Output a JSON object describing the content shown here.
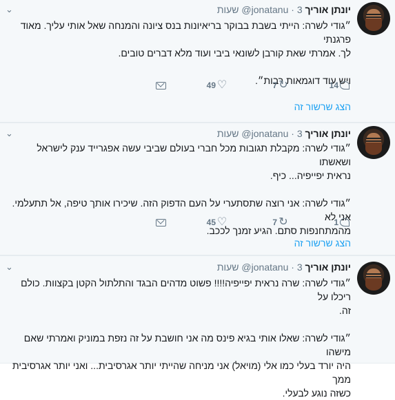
{
  "tweets": [
    {
      "name": "יונתן אוריך",
      "handle": "@jonatanu",
      "dot": "·",
      "time": "3 שעות",
      "lines": [
        "״גודי לשרה: הייתי בשבת בבוקר בריאיונות בנס ציונה והמנחה שאל אותי עליך. מאוד פרגנתי",
        "לך. אמרתי שאת קורבן לשונאי ביבי ועוד מלא דברים טובים.",
        "",
        "ויש עוד דוגמאות רבות״."
      ],
      "replies": "14",
      "retweets": "7",
      "likes": "49",
      "thread_link": "הצג שרשור זה"
    },
    {
      "name": "יונתן אוריך",
      "handle": "@jonatanu",
      "dot": "·",
      "time": "3 שעות",
      "lines": [
        "״גודי לשרה: מקבלת תגובות מכל חברי בעולם שביבי עשה אפגרייד ענק לישראל ושאשתו",
        "נראית יפייפיה... כיף.",
        "",
        "״גודי לשרה: אני רוצה שתסתערי על העם הדפוק הזה. שיכירו אותך טיפה, אל תתעלמי. אני לא",
        "מהמתחנפות סתם. הגיע זמנך לככב."
      ],
      "replies": "1",
      "retweets": "7",
      "likes": "45",
      "thread_link": "הצג שרשור זה"
    },
    {
      "name": "יונתן אוריך",
      "handle": "@jonatanu",
      "dot": "·",
      "time": "3 שעות",
      "lines": [
        "״גודי לשרה: שרה נראית יפייפיה!!!! פשוט מדהים הבגד והתלתול הקטן בקצוות. כולם ריכלו על",
        "זה.",
        "",
        "״גודי לשרה: שאלו אותי בגיא פינס מה אני חושבת על זה נזפת במוניק ואמרתי שאם מישהו",
        "היה יורד בעלי כמו אלי (מויאל) אני מניחה שהייתי יותר אגרסיבית... ואני יותר אגרסיבית ממך",
        "כשזה נוגע לבעלי."
      ]
    }
  ],
  "icons": {
    "caret": "chevron-down-icon",
    "reply": "reply-icon",
    "retweet": "retweet-icon",
    "like": "heart-icon",
    "dm": "mail-icon"
  }
}
